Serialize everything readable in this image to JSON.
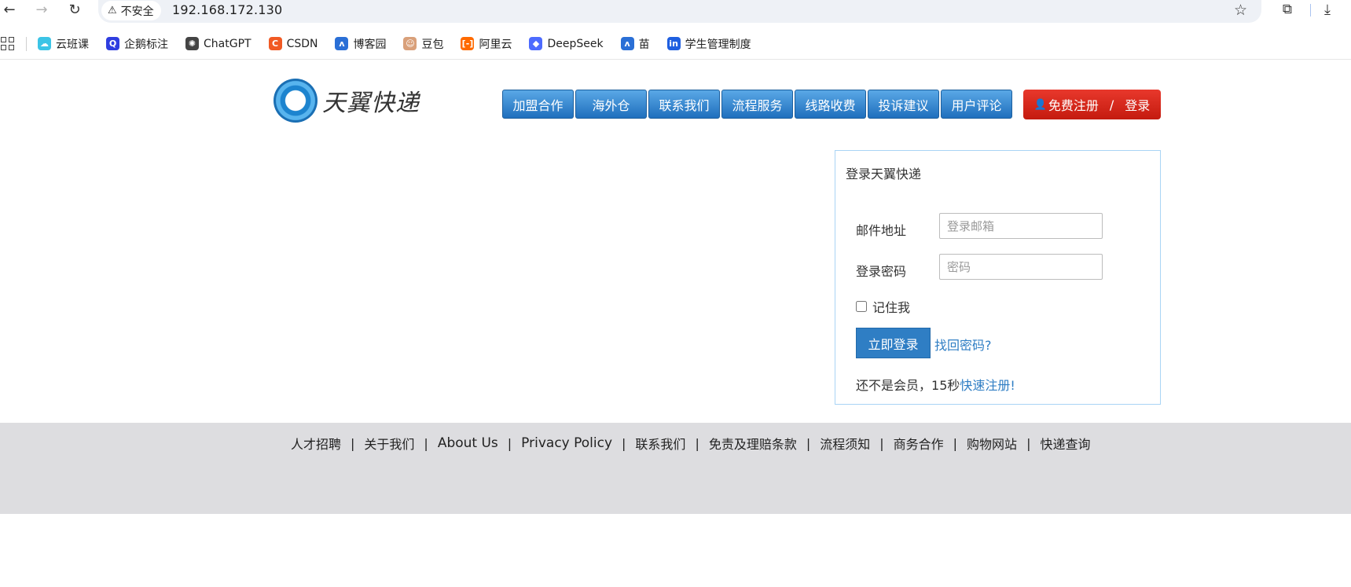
{
  "browser": {
    "security_label": "不安全",
    "url": "192.168.172.130",
    "bookmarks": [
      {
        "label": "云班课",
        "icon": "cloud-class-icon",
        "color": "#3cc4e6"
      },
      {
        "label": "企鹅标注",
        "icon": "penguin-label-icon",
        "color": "#2f3ee0"
      },
      {
        "label": "ChatGPT",
        "icon": "chatgpt-icon",
        "color": "#444444"
      },
      {
        "label": "CSDN",
        "icon": "csdn-icon",
        "color": "#f15a24"
      },
      {
        "label": "博客园",
        "icon": "cnblogs-icon",
        "color": "#2a6fd6"
      },
      {
        "label": "豆包",
        "icon": "doubao-icon",
        "color": "#d9a07a"
      },
      {
        "label": "阿里云",
        "icon": "aliyun-icon",
        "color": "#ff6a00"
      },
      {
        "label": "DeepSeek",
        "icon": "deepseek-icon",
        "color": "#4d6bfe"
      },
      {
        "label": "苗",
        "icon": "miao-icon",
        "color": "#2a6fd6"
      },
      {
        "label": "学生管理制度",
        "icon": "student-policy-icon",
        "color": "#1f5fe0"
      }
    ]
  },
  "site": {
    "logo_text": "天翼快递",
    "nav": [
      "加盟合作",
      "海外仓",
      "联系我们",
      "流程服务",
      "线路收费",
      "投诉建议",
      "用户评论"
    ],
    "register_label": "免费注册",
    "login_label": "登录",
    "accent_blue": "#2f7ec4",
    "accent_red": "#d3261a"
  },
  "login": {
    "title": "登录天翼快递",
    "email_label": "邮件地址",
    "email_placeholder": "登录邮箱",
    "password_label": "登录密码",
    "password_placeholder": "密码",
    "remember_label": "记住我",
    "submit_label": "立即登录",
    "forgot_label": "找回密码?",
    "member_prefix": "还不是会员，",
    "countdown": "15秒",
    "register_link": "快速注册!"
  },
  "footer": {
    "links": [
      "人才招聘",
      "关于我们",
      "About Us",
      "Privacy Policy",
      "联系我们",
      "免责及理赔条款",
      "流程须知",
      "商务合作",
      "购物网站",
      "快递查询"
    ]
  }
}
